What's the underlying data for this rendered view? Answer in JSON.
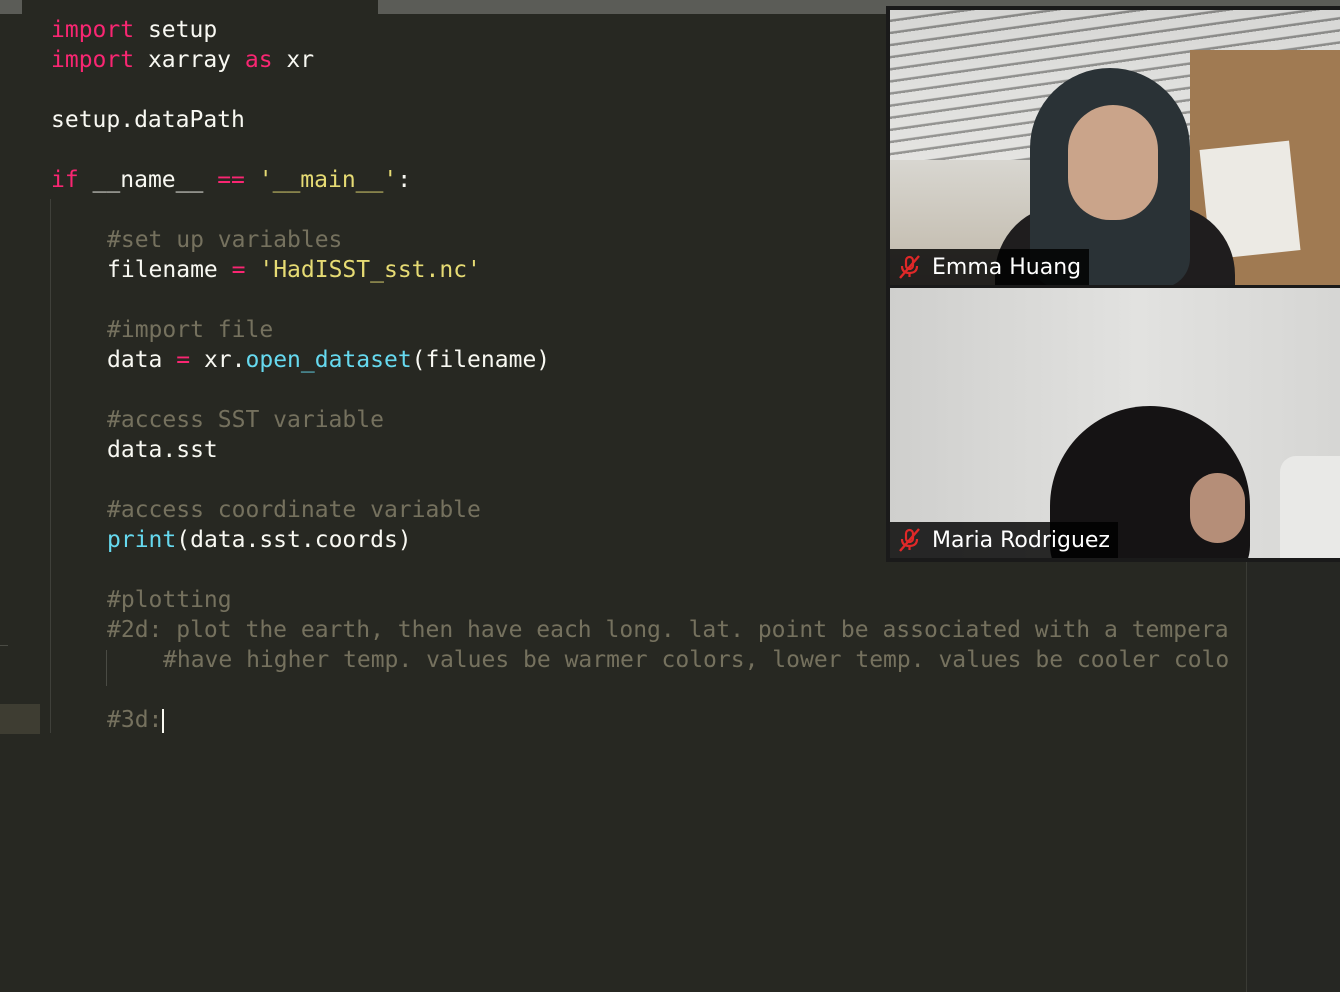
{
  "editor": {
    "lines": [
      {
        "p1": "import",
        "p2": " setup"
      },
      {
        "p1": "import",
        "p2": " xarray ",
        "p3": "as",
        "p4": " xr"
      },
      {
        "p1": "setup.dataPath"
      },
      {
        "p1": "if",
        "p2": " __name__ ",
        "p3": "==",
        "p4": " ",
        "p5": "'__main__'",
        "p6": ":"
      },
      {
        "p1": "#set up variables"
      },
      {
        "p1": "filename ",
        "p2": "=",
        "p3": " ",
        "p4": "'HadISST_sst.nc'"
      },
      {
        "p1": "#import file"
      },
      {
        "p1": "data ",
        "p2": "=",
        "p3": " xr.",
        "p4": "open_dataset",
        "p5": "(filename)"
      },
      {
        "p1": "#access SST variable"
      },
      {
        "p1": "data.sst"
      },
      {
        "p1": "#access coordinate variable"
      },
      {
        "p1": "print",
        "p2": "(data.sst.coords)"
      },
      {
        "p1": "#plotting"
      },
      {
        "p1": "#2d: plot the earth, then have each long. lat. point be associated with a tempera"
      },
      {
        "p1": "#have higher temp. values be warmer colors, lower temp. values be cooler colo"
      },
      {
        "p1": "#3d:"
      }
    ]
  },
  "video": {
    "participants": [
      {
        "name": "Emma Huang",
        "muted": true
      },
      {
        "name": "Maria Rodriguez",
        "muted": true
      }
    ]
  },
  "colors": {
    "background": "#272822",
    "keyword": "#f92672",
    "string": "#e6db74",
    "function": "#66d9ef",
    "comment": "#75715e",
    "text": "#f8f8f2",
    "mute_red": "#e02828"
  }
}
